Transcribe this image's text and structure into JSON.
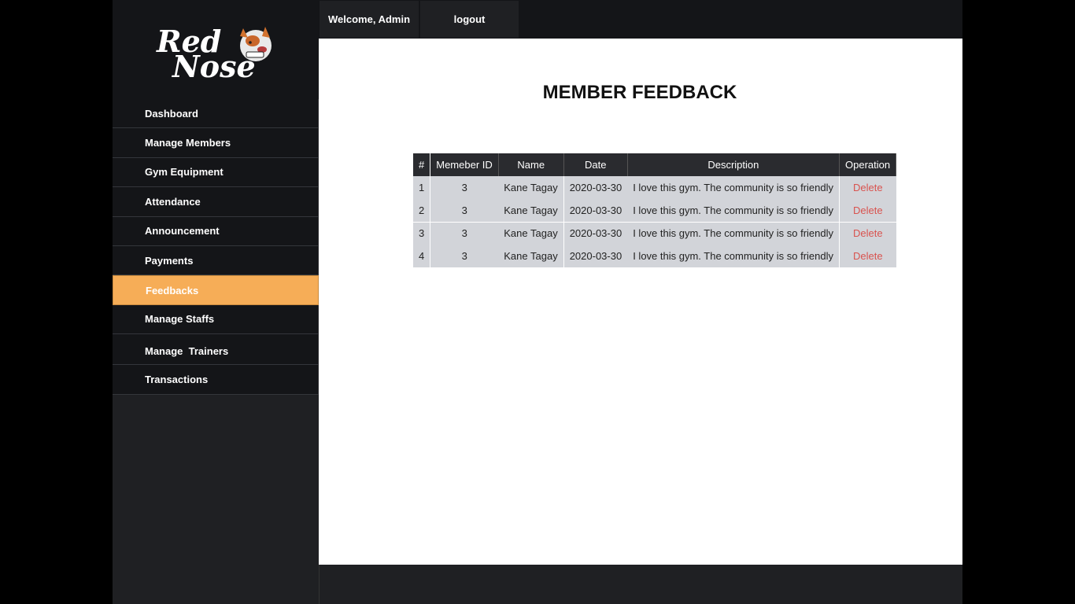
{
  "brand": {
    "logo_text_line1": "Red",
    "logo_text_line2": "Nose"
  },
  "topbar": {
    "welcome": "Welcome, Admin",
    "logout": "logout"
  },
  "sidebar": {
    "items": [
      {
        "label": "Dashboard"
      },
      {
        "label": "Manage Members"
      },
      {
        "label": "Gym Equipment"
      },
      {
        "label": "Attendance"
      },
      {
        "label": "Announcement"
      },
      {
        "label": "Payments"
      },
      {
        "label": "Feedbacks",
        "active": true
      },
      {
        "label": "Manage Staffs"
      },
      {
        "label": "Manage  Trainers"
      },
      {
        "label": "Transactions"
      }
    ]
  },
  "page": {
    "title": "MEMBER FEEDBACK"
  },
  "table": {
    "headers": [
      "#",
      "Memeber ID",
      "Name",
      "Date",
      "Description",
      "Operation"
    ],
    "rows": [
      [
        "1",
        "3",
        "Kane Tagay",
        "2020-03-30",
        "I love this gym. The community is so friendly",
        "Delete"
      ],
      [
        "2",
        "3",
        "Kane Tagay",
        "2020-03-30",
        "I love this gym. The community is so friendly",
        "Delete"
      ],
      [
        "3",
        "3",
        "Kane Tagay",
        "2020-03-30",
        "I love this gym. The community is so friendly",
        "Delete"
      ],
      [
        "4",
        "3",
        "Kane Tagay",
        "2020-03-30",
        "I love this gym. The community is so friendly",
        "Delete"
      ]
    ]
  },
  "colors": {
    "accent": "#f6ad57",
    "delete": "#d9534f",
    "sidebar_bg": "#141518"
  }
}
